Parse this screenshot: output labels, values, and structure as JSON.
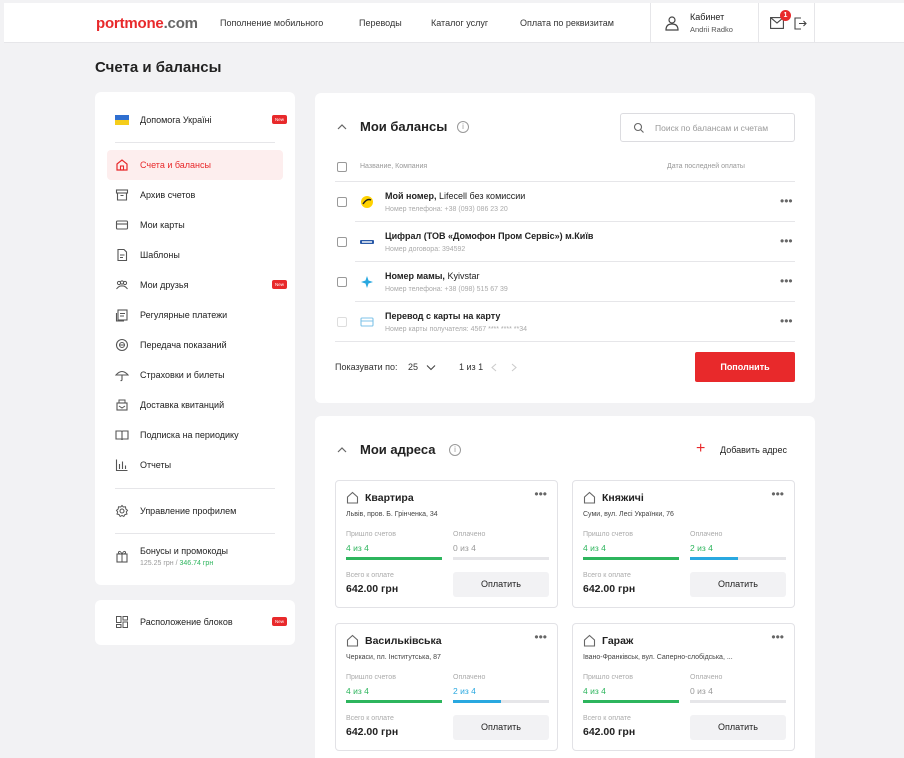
{
  "header": {
    "logo_a": "portmone",
    "logo_b": ".com",
    "nav": [
      "Пополнение мобильного",
      "Переводы",
      "Каталог услуг",
      "Оплата по реквизитам"
    ],
    "cabinet_title": "Кабинет",
    "cabinet_user": "Andrii Radko",
    "mail_badge": "1"
  },
  "page_title": "Счета и балансы",
  "sidebar": {
    "promo": {
      "label": "Допомога Україні",
      "badge": "New"
    },
    "items": [
      {
        "label": "Счета и балансы",
        "icon": "home-icon"
      },
      {
        "label": "Архив счетов",
        "icon": "archive-icon"
      },
      {
        "label": "Мои карты",
        "icon": "card-icon"
      },
      {
        "label": "Шаблоны",
        "icon": "template-icon"
      },
      {
        "label": "Мои друзья",
        "icon": "friends-icon",
        "badge": "New"
      },
      {
        "label": "Регулярные платежи",
        "icon": "recurring-icon"
      },
      {
        "label": "Передача показаний",
        "icon": "meter-icon"
      },
      {
        "label": "Страховки и билеты",
        "icon": "umbrella-icon"
      },
      {
        "label": "Доставка квитанций",
        "icon": "delivery-icon"
      },
      {
        "label": "Подписка на периодику",
        "icon": "book-icon"
      },
      {
        "label": "Отчеты",
        "icon": "chart-icon"
      }
    ],
    "profile": "Управление профилем",
    "bonus": {
      "label": "Бонусы и промокоды",
      "amount1": "125.25 грн",
      "sep": " / ",
      "amount2": "346.74 грн"
    },
    "layout": {
      "label": "Расположение блоков",
      "badge": "New"
    }
  },
  "balances": {
    "title": "Мои балансы",
    "search_placeholder": "Поиск по балансам и счетам",
    "col_name": "Название, Компания",
    "col_date": "Дата последней оплаты",
    "rows": [
      {
        "title": "Мой номер,",
        "company": " Lifecell без комиссии",
        "sub": "Номер телефона: +38 (093) 086 23 20",
        "icon": "lifecell-icon"
      },
      {
        "title": "Цифрал (ТОВ «Домофон Пром Сервіс») м.Київ",
        "company": "",
        "sub": "Номер договора: 394592",
        "icon": "cifral-icon"
      },
      {
        "title": "Номер мамы,",
        "company": " Kyivstar",
        "sub": "Номер телефона: +38 (098) 515 67 39",
        "icon": "kyivstar-icon"
      },
      {
        "title": "Перевод с карты на карту",
        "company": "",
        "sub": "Номер карты получателя: 4567 **** **** **34",
        "icon": "card-transfer-icon"
      }
    ],
    "per_page_label": "Показувати по:",
    "per_page_value": "25",
    "page_info": "1 из 1",
    "topup": "Пополнить"
  },
  "addresses": {
    "title": "Мои адреса",
    "add": "Добавить адрес",
    "labels": {
      "came": "Пришло счетов",
      "paid": "Оплачено",
      "total": "Всего к оплате",
      "pay": "Оплатить"
    },
    "items": [
      {
        "name": "Квартира",
        "address": "Львів, пров. Б. Грінченка, 34",
        "came": "4 из 4",
        "paid": "0 из 4",
        "paid_fraction": 0,
        "total": "642.00 грн"
      },
      {
        "name": "Княжичі",
        "address": "Суми, вул. Лесі Українки, 76",
        "came": "4 из 4",
        "paid": "2 из 4",
        "paid_fraction": 0.5,
        "total": "642.00 грн"
      },
      {
        "name": "Васильківська",
        "address": "Черкаси, пл. Інститутська, 87",
        "came": "4 из 4",
        "paid": "2 из 4",
        "paid_fraction": 0.5,
        "total": "642.00 грн"
      },
      {
        "name": "Гараж",
        "address": "Івано-Франківськ, вул. Саперно-слобідська, ...",
        "came": "4 из 4",
        "paid": "0 из 4",
        "paid_fraction": 0,
        "total": "642.00 грн"
      }
    ]
  },
  "colors": {
    "accent": "#e8292b",
    "green": "#2db55d",
    "blue": "#29a8e0"
  }
}
